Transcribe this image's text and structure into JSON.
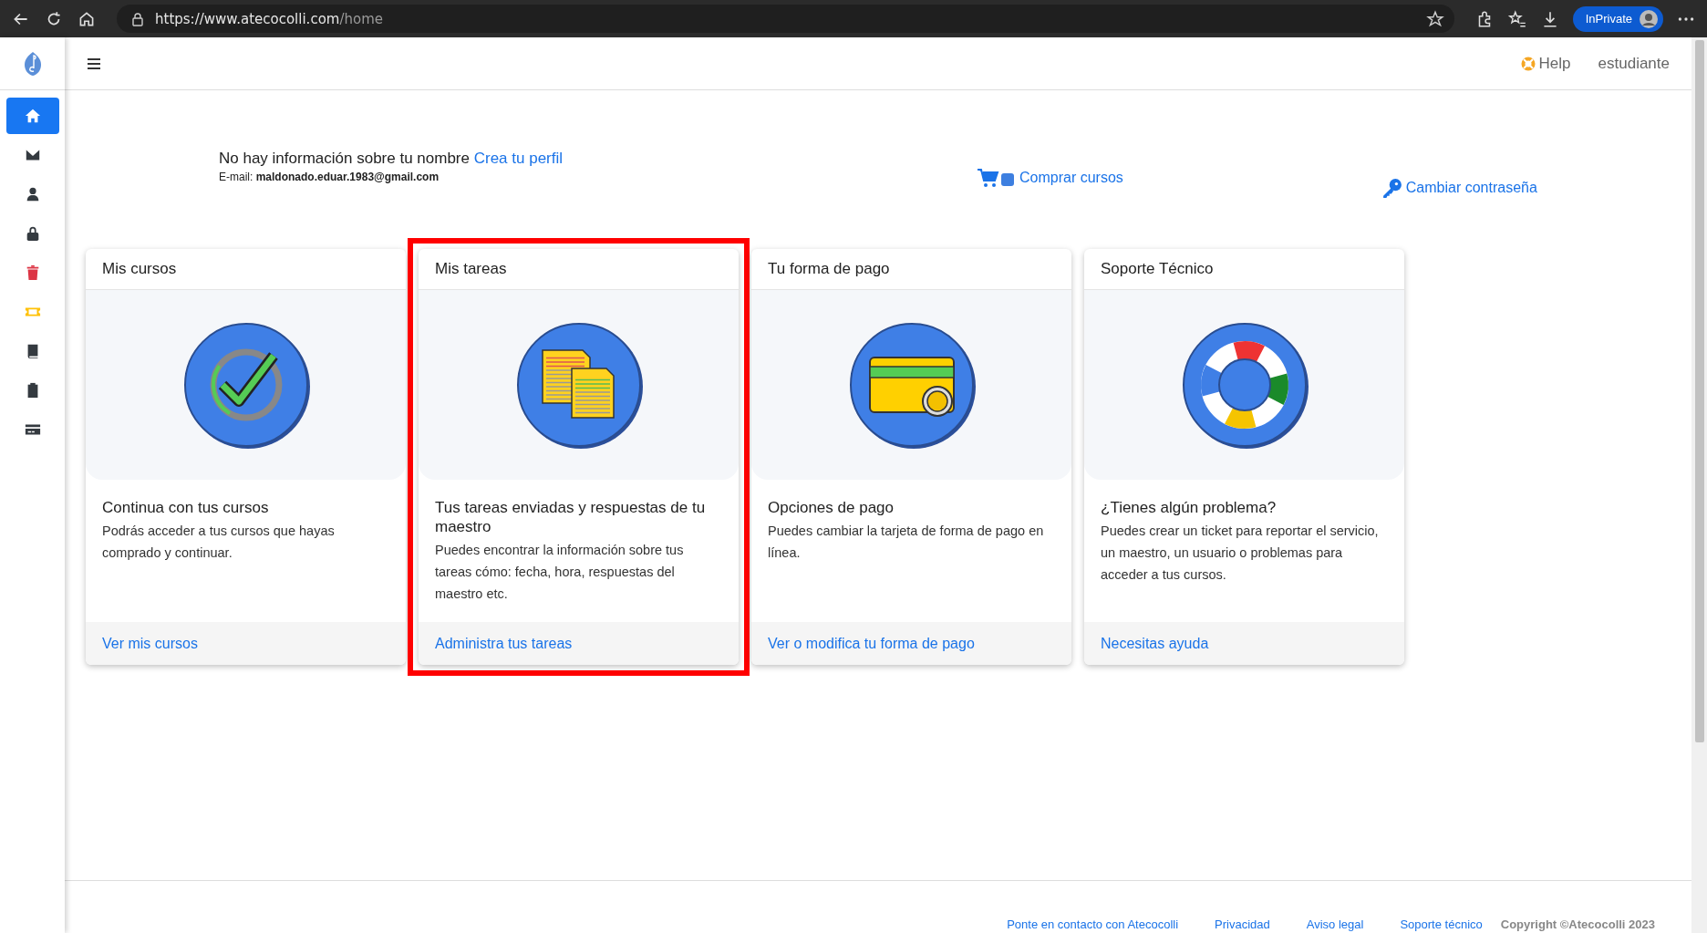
{
  "browser": {
    "url_host": "https://www.atecocolli.com",
    "url_path": "/home",
    "private_label": "InPrivate"
  },
  "sidebar": {
    "items": [
      {
        "kind": "home",
        "selected": true,
        "color": "#ffffff"
      },
      {
        "kind": "mail",
        "selected": false,
        "color": "#343a40"
      },
      {
        "kind": "user",
        "selected": false,
        "color": "#343a40"
      },
      {
        "kind": "lock",
        "selected": false,
        "color": "#343a40"
      },
      {
        "kind": "trash",
        "selected": false,
        "color": "#dc3545"
      },
      {
        "kind": "ticket",
        "selected": false,
        "color": "#ffc107"
      },
      {
        "kind": "book",
        "selected": false,
        "color": "#343a40"
      },
      {
        "kind": "clipboard",
        "selected": false,
        "color": "#343a40"
      },
      {
        "kind": "card",
        "selected": false,
        "color": "#343a40"
      }
    ]
  },
  "header": {
    "help": "Help",
    "user": "estudiante"
  },
  "profile": {
    "message": "No hay información sobre tu nombre",
    "link": "Crea tu perfil",
    "email_label": "E-mail:",
    "email": "maldonado.eduar.1983@gmail.com"
  },
  "actions": {
    "buy": "Comprar cursos",
    "password": "Cambiar contraseña"
  },
  "cards": [
    {
      "kind": "check",
      "title": "Mis cursos",
      "heading": "Continua con tus cursos",
      "text": "Podrás acceder a tus cursos que hayas comprado y continuar.",
      "link": "Ver mis cursos",
      "highlighted": false
    },
    {
      "kind": "documents",
      "title": "Mis tareas",
      "heading": "Tus tareas enviadas y respuestas de tu maestro",
      "text": "Puedes encontrar la información sobre tus tareas cómo: fecha, hora, respuestas del maestro etc.",
      "link": "Administra tus tareas",
      "highlighted": true
    },
    {
      "kind": "payment",
      "title": "Tu forma de pago",
      "heading": "Opciones de pago",
      "text": "Puedes cambiar la tarjeta de forma de pago en línea.",
      "link": "Ver o modifica tu forma de pago",
      "highlighted": false
    },
    {
      "kind": "lifebuoy",
      "title": "Soporte Técnico",
      "heading": "¿Tienes algún problema?",
      "text": "Puedes crear un ticket para reportar el servicio, un maestro, un usuario o problemas para acceder a tus cursos.",
      "link": "Necesitas ayuda",
      "highlighted": false
    }
  ],
  "footer": {
    "links": [
      "Ponte en contacto con Atecocolli",
      "Privacidad",
      "Aviso legal",
      "Soporte técnico"
    ],
    "copyright": "Copyright ©Atecocolli 2023"
  }
}
